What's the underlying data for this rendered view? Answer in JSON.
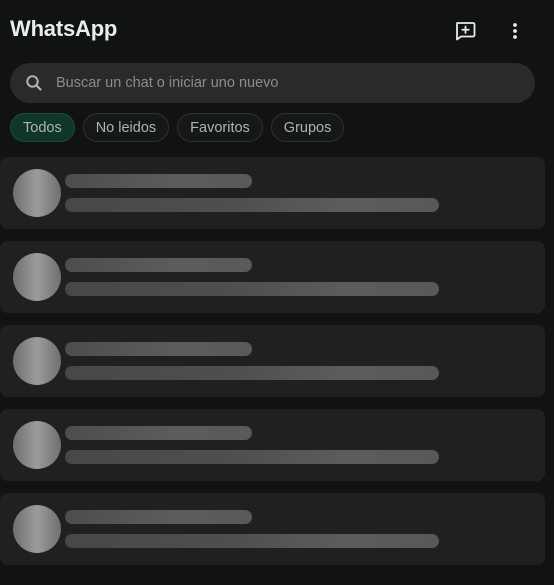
{
  "app": {
    "title": "WhatsApp"
  },
  "toolbar": {
    "new_chat_icon": "new-chat-icon",
    "menu_icon": "vertical-dots-icon"
  },
  "search": {
    "placeholder": "Buscar un chat o iniciar uno nuevo",
    "value": "",
    "icon": "search-icon"
  },
  "filters": [
    {
      "label": "Todos",
      "active": true
    },
    {
      "label": "No leidos",
      "active": false
    },
    {
      "label": "Favoritos",
      "active": false
    },
    {
      "label": "Grupos",
      "active": false
    }
  ],
  "chat_list": {
    "state": "loading",
    "placeholder_rows": 5
  },
  "colors": {
    "background": "#111312",
    "row_background": "#202020",
    "search_background": "#2a2a2a",
    "active_chip": "#103529",
    "text": "#e9edef",
    "muted_text": "#aeb3b5"
  }
}
